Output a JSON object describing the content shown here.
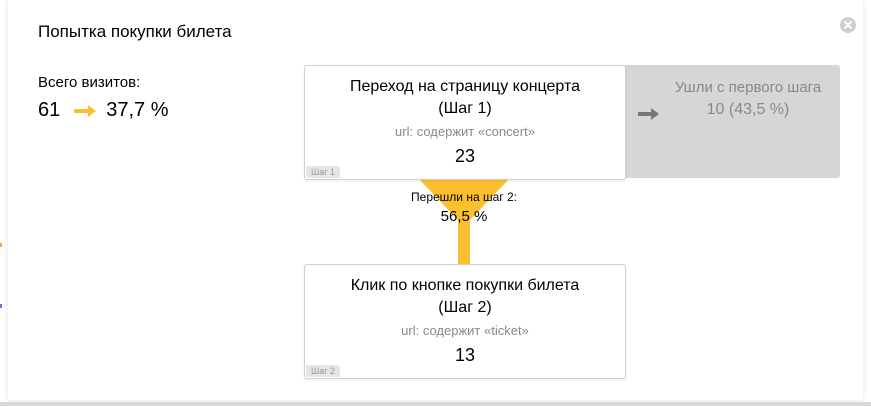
{
  "dialog": {
    "title": "Попытка покупки билета"
  },
  "totals": {
    "label": "Всего визитов:",
    "visits": "61",
    "conversion": "37,7 %"
  },
  "steps": [
    {
      "title_line1": "Переход на страницу концерта",
      "title_line2": "(Шаг 1)",
      "condition": "url: содержит «concert»",
      "count": "23",
      "badge": "Шаг 1"
    },
    {
      "title_line1": "Клик по кнопке покупки билета",
      "title_line2": "(Шаг 2)",
      "condition": "url: содержит «ticket»",
      "count": "13",
      "badge": "Шаг 2"
    }
  ],
  "exit": {
    "label": "Ушли с первого шага",
    "value": "10 (43,5 %)"
  },
  "transition": {
    "label": "Перешли на шаг 2:",
    "value": "56,5 %"
  },
  "colors": {
    "accent": "#fcbf2e",
    "exit_bg": "#d6d6d6",
    "muted_text": "#888888"
  },
  "icons": {
    "close": "close-icon",
    "total_arrow": "arrow-right-icon",
    "exit_arrow": "arrow-right-icon",
    "funnel": "funnel-shape"
  }
}
